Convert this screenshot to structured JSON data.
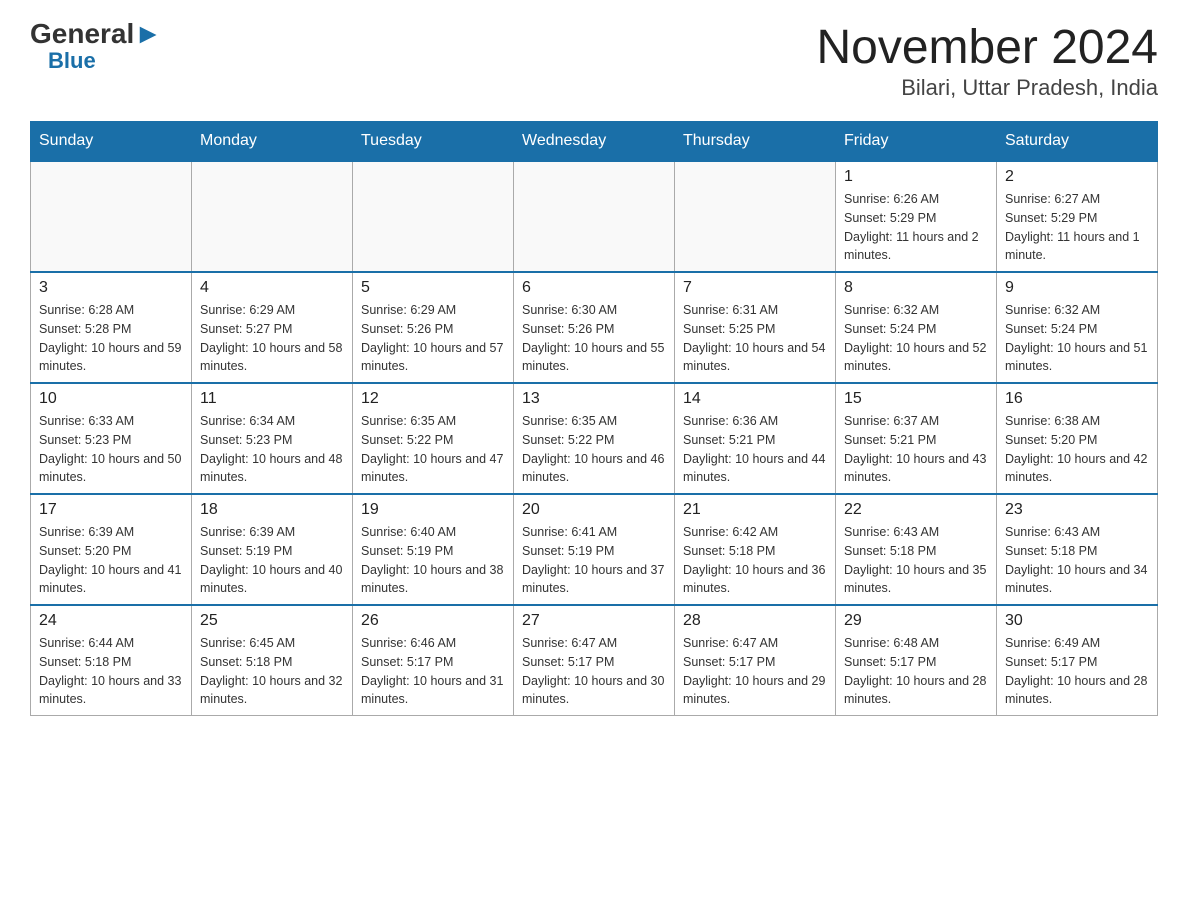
{
  "header": {
    "logo_general": "General",
    "logo_blue": "Blue",
    "title": "November 2024",
    "subtitle": "Bilari, Uttar Pradesh, India"
  },
  "days_of_week": [
    "Sunday",
    "Monday",
    "Tuesday",
    "Wednesday",
    "Thursday",
    "Friday",
    "Saturday"
  ],
  "weeks": [
    [
      {
        "day": "",
        "info": ""
      },
      {
        "day": "",
        "info": ""
      },
      {
        "day": "",
        "info": ""
      },
      {
        "day": "",
        "info": ""
      },
      {
        "day": "",
        "info": ""
      },
      {
        "day": "1",
        "info": "Sunrise: 6:26 AM\nSunset: 5:29 PM\nDaylight: 11 hours and 2 minutes."
      },
      {
        "day": "2",
        "info": "Sunrise: 6:27 AM\nSunset: 5:29 PM\nDaylight: 11 hours and 1 minute."
      }
    ],
    [
      {
        "day": "3",
        "info": "Sunrise: 6:28 AM\nSunset: 5:28 PM\nDaylight: 10 hours and 59 minutes."
      },
      {
        "day": "4",
        "info": "Sunrise: 6:29 AM\nSunset: 5:27 PM\nDaylight: 10 hours and 58 minutes."
      },
      {
        "day": "5",
        "info": "Sunrise: 6:29 AM\nSunset: 5:26 PM\nDaylight: 10 hours and 57 minutes."
      },
      {
        "day": "6",
        "info": "Sunrise: 6:30 AM\nSunset: 5:26 PM\nDaylight: 10 hours and 55 minutes."
      },
      {
        "day": "7",
        "info": "Sunrise: 6:31 AM\nSunset: 5:25 PM\nDaylight: 10 hours and 54 minutes."
      },
      {
        "day": "8",
        "info": "Sunrise: 6:32 AM\nSunset: 5:24 PM\nDaylight: 10 hours and 52 minutes."
      },
      {
        "day": "9",
        "info": "Sunrise: 6:32 AM\nSunset: 5:24 PM\nDaylight: 10 hours and 51 minutes."
      }
    ],
    [
      {
        "day": "10",
        "info": "Sunrise: 6:33 AM\nSunset: 5:23 PM\nDaylight: 10 hours and 50 minutes."
      },
      {
        "day": "11",
        "info": "Sunrise: 6:34 AM\nSunset: 5:23 PM\nDaylight: 10 hours and 48 minutes."
      },
      {
        "day": "12",
        "info": "Sunrise: 6:35 AM\nSunset: 5:22 PM\nDaylight: 10 hours and 47 minutes."
      },
      {
        "day": "13",
        "info": "Sunrise: 6:35 AM\nSunset: 5:22 PM\nDaylight: 10 hours and 46 minutes."
      },
      {
        "day": "14",
        "info": "Sunrise: 6:36 AM\nSunset: 5:21 PM\nDaylight: 10 hours and 44 minutes."
      },
      {
        "day": "15",
        "info": "Sunrise: 6:37 AM\nSunset: 5:21 PM\nDaylight: 10 hours and 43 minutes."
      },
      {
        "day": "16",
        "info": "Sunrise: 6:38 AM\nSunset: 5:20 PM\nDaylight: 10 hours and 42 minutes."
      }
    ],
    [
      {
        "day": "17",
        "info": "Sunrise: 6:39 AM\nSunset: 5:20 PM\nDaylight: 10 hours and 41 minutes."
      },
      {
        "day": "18",
        "info": "Sunrise: 6:39 AM\nSunset: 5:19 PM\nDaylight: 10 hours and 40 minutes."
      },
      {
        "day": "19",
        "info": "Sunrise: 6:40 AM\nSunset: 5:19 PM\nDaylight: 10 hours and 38 minutes."
      },
      {
        "day": "20",
        "info": "Sunrise: 6:41 AM\nSunset: 5:19 PM\nDaylight: 10 hours and 37 minutes."
      },
      {
        "day": "21",
        "info": "Sunrise: 6:42 AM\nSunset: 5:18 PM\nDaylight: 10 hours and 36 minutes."
      },
      {
        "day": "22",
        "info": "Sunrise: 6:43 AM\nSunset: 5:18 PM\nDaylight: 10 hours and 35 minutes."
      },
      {
        "day": "23",
        "info": "Sunrise: 6:43 AM\nSunset: 5:18 PM\nDaylight: 10 hours and 34 minutes."
      }
    ],
    [
      {
        "day": "24",
        "info": "Sunrise: 6:44 AM\nSunset: 5:18 PM\nDaylight: 10 hours and 33 minutes."
      },
      {
        "day": "25",
        "info": "Sunrise: 6:45 AM\nSunset: 5:18 PM\nDaylight: 10 hours and 32 minutes."
      },
      {
        "day": "26",
        "info": "Sunrise: 6:46 AM\nSunset: 5:17 PM\nDaylight: 10 hours and 31 minutes."
      },
      {
        "day": "27",
        "info": "Sunrise: 6:47 AM\nSunset: 5:17 PM\nDaylight: 10 hours and 30 minutes."
      },
      {
        "day": "28",
        "info": "Sunrise: 6:47 AM\nSunset: 5:17 PM\nDaylight: 10 hours and 29 minutes."
      },
      {
        "day": "29",
        "info": "Sunrise: 6:48 AM\nSunset: 5:17 PM\nDaylight: 10 hours and 28 minutes."
      },
      {
        "day": "30",
        "info": "Sunrise: 6:49 AM\nSunset: 5:17 PM\nDaylight: 10 hours and 28 minutes."
      }
    ]
  ]
}
